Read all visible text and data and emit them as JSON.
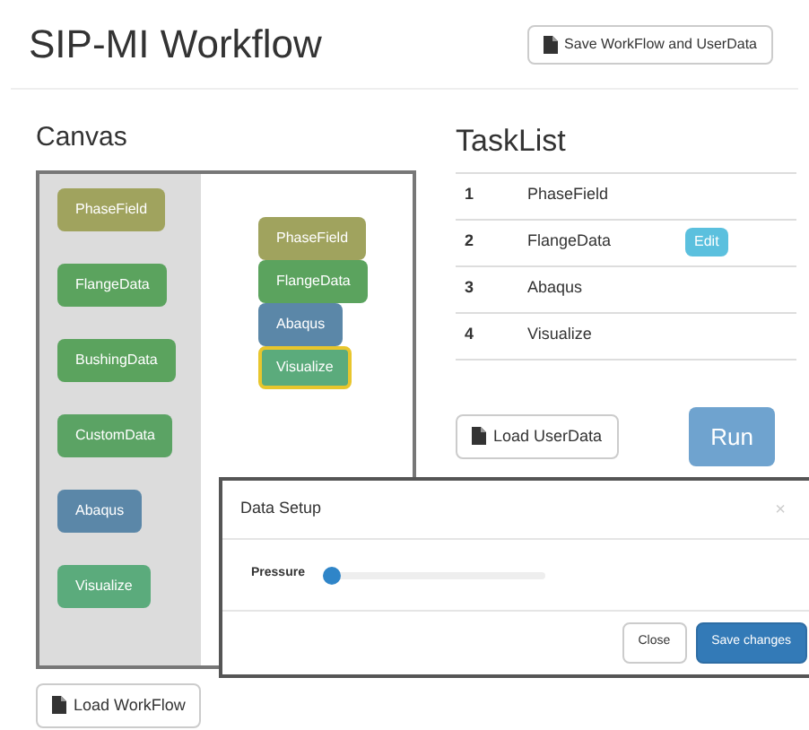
{
  "header": {
    "title": "SIP-MI Workflow",
    "save_button": "Save WorkFlow and UserData"
  },
  "canvas": {
    "heading": "Canvas",
    "palette": [
      {
        "label": "PhaseField",
        "color": "#a0a35e"
      },
      {
        "label": "FlangeData",
        "color": "#5ba35e"
      },
      {
        "label": "BushingData",
        "color": "#5ba35e"
      },
      {
        "label": "CustomData",
        "color": "#5ba364"
      },
      {
        "label": "Abaqus",
        "color": "#5b87a8"
      },
      {
        "label": "Visualize",
        "color": "#5bab7c"
      }
    ],
    "workspace": [
      {
        "label": "PhaseField",
        "color": "#a0a35e",
        "selected": false
      },
      {
        "label": "FlangeData",
        "color": "#5ba35e",
        "selected": false
      },
      {
        "label": "Abaqus",
        "color": "#5b87a8",
        "selected": false
      },
      {
        "label": "Visualize",
        "color": "#5bab7c",
        "selected": true
      }
    ],
    "load_button": "Load WorkFlow"
  },
  "tasklist": {
    "heading": "TaskList",
    "rows": [
      {
        "number": "1",
        "name": "PhaseField"
      },
      {
        "number": "2",
        "name": "FlangeData",
        "action": "Edit"
      },
      {
        "number": "3",
        "name": "Abaqus"
      },
      {
        "number": "4",
        "name": "Visualize"
      }
    ],
    "load_button": "Load UserData",
    "run_button": "Run"
  },
  "dialog": {
    "title": "Data Setup",
    "close_glyph": "×",
    "fields": [
      {
        "label": "Pressure",
        "level": 0
      }
    ],
    "buttons": [
      {
        "label": "Close",
        "kind": "default"
      },
      {
        "label": "Save changes",
        "kind": "primary"
      }
    ]
  }
}
